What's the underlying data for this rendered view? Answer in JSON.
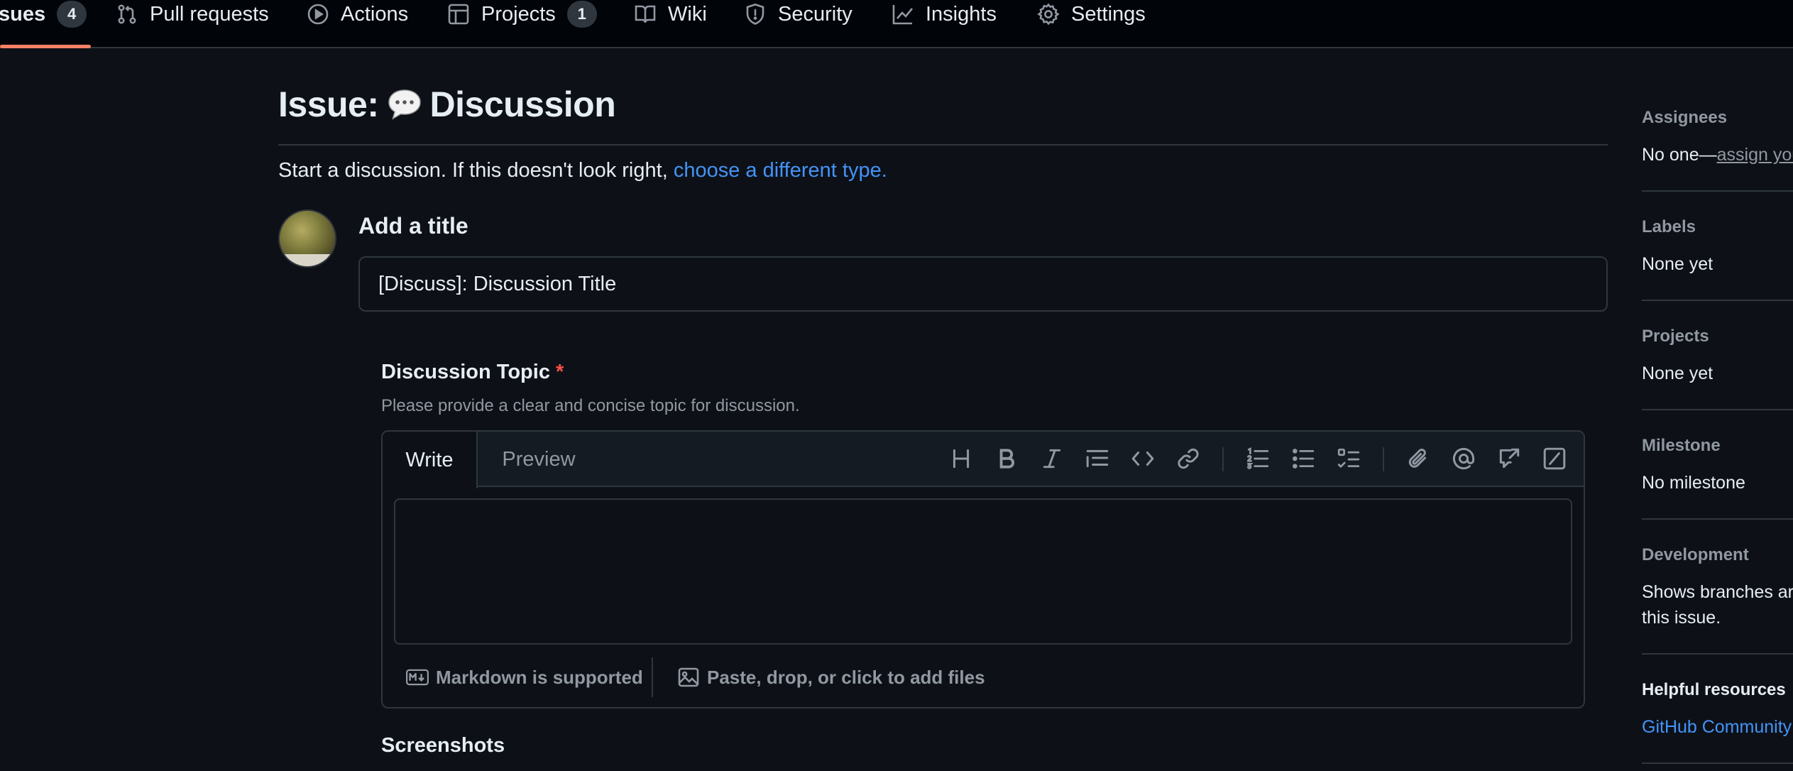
{
  "nav": {
    "items": [
      {
        "label": "sues",
        "count": "4"
      },
      {
        "label": "Pull requests"
      },
      {
        "label": "Actions"
      },
      {
        "label": "Projects",
        "count": "1"
      },
      {
        "label": "Wiki"
      },
      {
        "label": "Security"
      },
      {
        "label": "Insights"
      },
      {
        "label": "Settings"
      }
    ],
    "active_underline_color": "#f78166"
  },
  "header": {
    "title_prefix": "Issue:",
    "title_emoji": "speech-balloon-icon",
    "title_type": "Discussion",
    "intro_text": "Start a discussion. If this doesn't look right,",
    "intro_link": "choose a different type."
  },
  "form": {
    "title_label": "Add a title",
    "title_value": "[Discuss]: Discussion Title",
    "topic_label": "Discussion Topic",
    "required_marker": "*",
    "topic_help": "Please provide a clear and concise topic for discussion.",
    "tabs": {
      "write": "Write",
      "preview": "Preview"
    },
    "toolbar_icons": [
      "heading-icon",
      "bold-icon",
      "italic-icon",
      "quote-icon",
      "code-icon",
      "link-icon",
      "ordered-list-icon",
      "unordered-list-icon",
      "task-list-icon",
      "attach-icon",
      "mention-icon",
      "reference-icon",
      "slash-commands-icon"
    ],
    "textarea_value": "",
    "markdown_note": "Markdown is supported",
    "files_note": "Paste, drop, or click to add files",
    "next_section": "Screenshots"
  },
  "sidebar": {
    "assignees": {
      "heading": "Assignees",
      "value_prefix": "No one—",
      "value_link": "assign you"
    },
    "labels": {
      "heading": "Labels",
      "value": "None yet"
    },
    "projects": {
      "heading": "Projects",
      "value": "None yet"
    },
    "milestone": {
      "heading": "Milestone",
      "value": "No milestone"
    },
    "development": {
      "heading": "Development",
      "line1": "Shows branches ar",
      "line2": "this issue."
    },
    "helpful": {
      "heading": "Helpful resources",
      "link": "GitHub Community"
    }
  },
  "colors": {
    "background": "#0d1117",
    "link": "#4493f8",
    "required": "#f85149",
    "border": "#30363d"
  }
}
